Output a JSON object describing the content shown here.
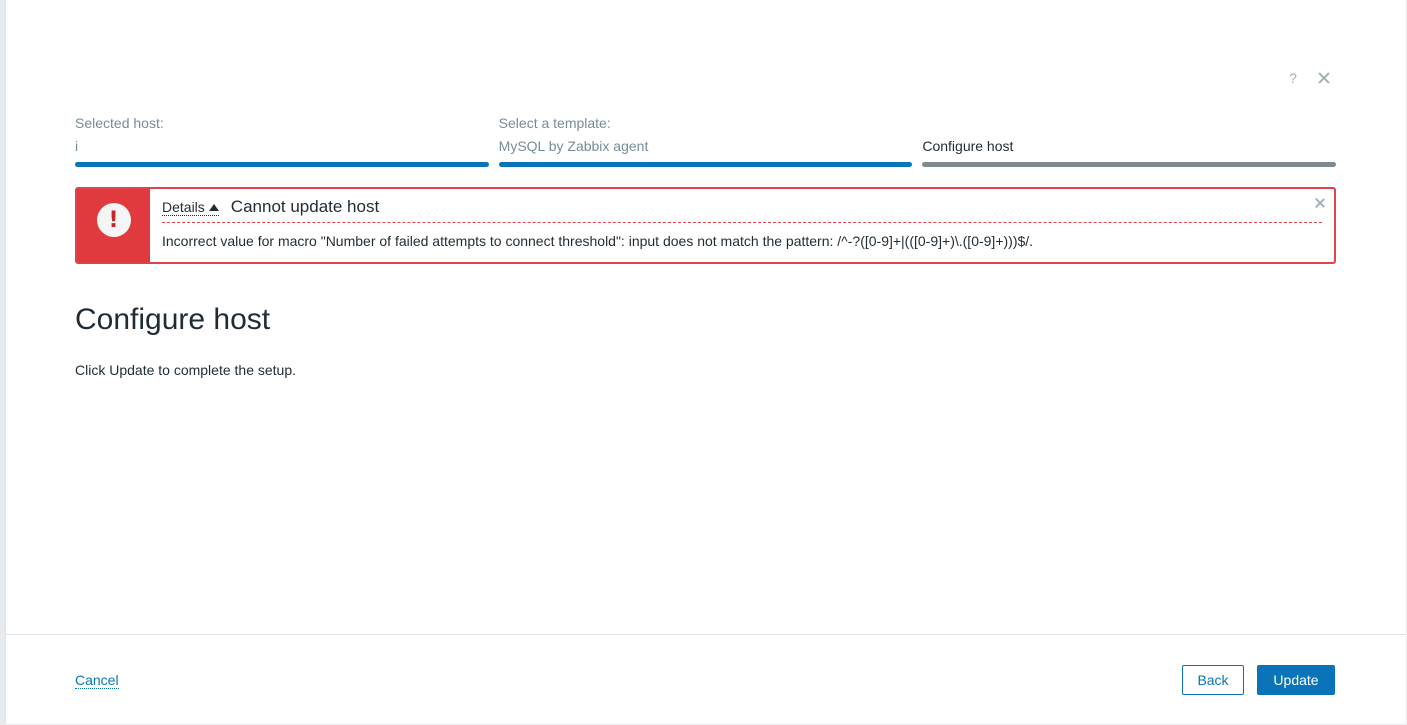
{
  "header": {
    "help_symbol": "?",
    "close_icon": "close-icon"
  },
  "steps": [
    {
      "label": "Selected host:",
      "value": "i",
      "state": "done"
    },
    {
      "label": "Select a template:",
      "value": "MySQL by Zabbix agent",
      "state": "done"
    },
    {
      "label": "",
      "value": "Configure host",
      "state": "current"
    }
  ],
  "error": {
    "icon": "exclamation-icon",
    "details_label": "Details",
    "title": "Cannot update host",
    "message": "Incorrect value for macro \"Number of failed attempts to connect threshold\": input does not match the pattern: /^-?([0-9]+|(([0-9]+)\\.([0-9]+)))$/.",
    "accent_color": "#e0393e"
  },
  "main": {
    "title": "Configure host",
    "description": "Click Update to complete the setup."
  },
  "footer": {
    "cancel_label": "Cancel",
    "back_label": "Back",
    "update_label": "Update",
    "primary_color": "#0a74b8"
  }
}
